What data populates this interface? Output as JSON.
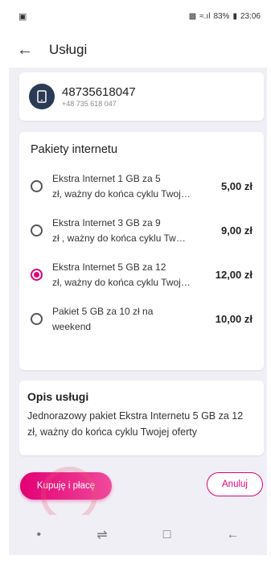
{
  "status_bar": {
    "battery": "83%",
    "time": "23:06"
  },
  "app_bar": {
    "title": "Usługi",
    "back_icon": "arrow-back-icon"
  },
  "number": {
    "main": "48735618047",
    "sub": "+48 735 618 047",
    "icon": "phone-icon"
  },
  "packages": {
    "title": "Pakiety internetu",
    "items": [
      {
        "line1": "Ekstra Internet 1 GB za 5",
        "line2": "zł, ważny do końca cyklu Twojej oferty",
        "price": "5,00 zł",
        "selected": false
      },
      {
        "line1": "Ekstra Internet 3 GB za 9",
        "line2": "zł , ważny do końca cyklu Twojej oferty",
        "price": "9,00 zł",
        "selected": false
      },
      {
        "line1": "Ekstra Internet 5 GB za 12",
        "line2": "zł, ważny do końca cyklu Twojej oferty",
        "price": "12,00 zł",
        "selected": true
      },
      {
        "line1": "Pakiet 5 GB za 10 zł na",
        "line2": "weekend",
        "price": "10,00 zł",
        "selected": false
      }
    ]
  },
  "description": {
    "title": "Opis usługi",
    "body": "Jednorazowy pakiet Ekstra Internetu 5 GB za 12 zł, ważny do końca cyklu Twojej oferty"
  },
  "actions": {
    "buy_label": "Kupuję i płacę",
    "cancel_label": "Anuluj"
  },
  "colors": {
    "accent": "#e20074",
    "background": "#f1eff6",
    "phone_icon_bg": "#2b3a55"
  }
}
